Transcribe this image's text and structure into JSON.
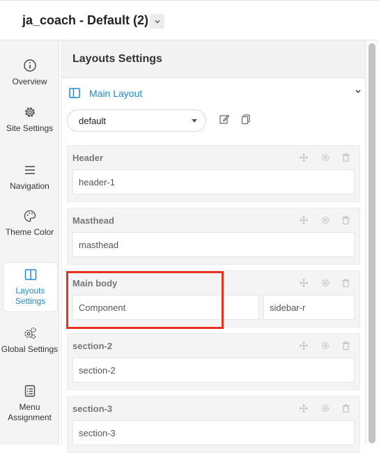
{
  "header": {
    "title": "ja_coach - Default (2)"
  },
  "sidebar": {
    "items": [
      {
        "label": "Overview",
        "icon": "info-circle-icon"
      },
      {
        "label": "Site Settings",
        "icon": "gear-icon"
      },
      {
        "label": "Navigation",
        "icon": "hamburger-menu-icon"
      },
      {
        "label": "Theme Color",
        "icon": "palette-icon"
      },
      {
        "label": "Layouts Settings",
        "icon": "layout-columns-icon",
        "active": true
      },
      {
        "label": "Global Settings",
        "icon": "gears-icon"
      },
      {
        "label": "Menu Assignment",
        "icon": "list-document-icon"
      }
    ]
  },
  "panel": {
    "title": "Layouts Settings",
    "main_layout_label": "Main Layout",
    "layout_select_value": "default"
  },
  "blocks": [
    {
      "title": "Header",
      "fields": [
        "header-1"
      ]
    },
    {
      "title": "Masthead",
      "fields": [
        "masthead"
      ]
    },
    {
      "title": "Main body",
      "fields": [
        "Component",
        "sidebar-r"
      ]
    },
    {
      "title": "section-2",
      "fields": [
        "section-2"
      ]
    },
    {
      "title": "section-3",
      "fields": [
        "section-3"
      ]
    }
  ],
  "colors": {
    "accent": "#1a8ad8",
    "highlight": "#e8321f"
  }
}
